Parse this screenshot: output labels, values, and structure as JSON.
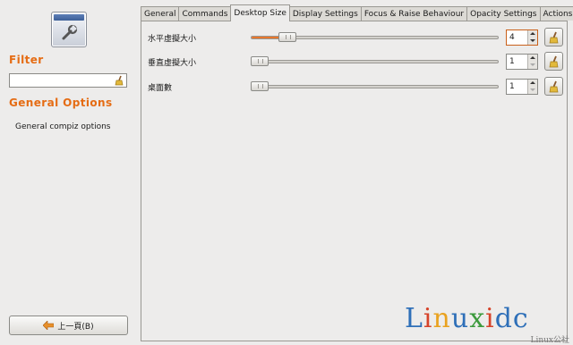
{
  "sidebar": {
    "filter_title": "Filter",
    "filter_value": "",
    "options_title": "General Options",
    "general_link": "General compiz options",
    "back_label": "上一頁(B)"
  },
  "tabs": [
    {
      "label": "General",
      "active": false
    },
    {
      "label": "Commands",
      "active": false
    },
    {
      "label": "Desktop Size",
      "active": true
    },
    {
      "label": "Display Settings",
      "active": false
    },
    {
      "label": "Focus & Raise Behaviour",
      "active": false
    },
    {
      "label": "Opacity Settings",
      "active": false
    },
    {
      "label": "Actions",
      "active": false
    }
  ],
  "settings": [
    {
      "label": "水平虛擬大小",
      "value": "4",
      "slider_fraction": 0.12,
      "focused": true
    },
    {
      "label": "垂直虛擬大小",
      "value": "1",
      "slider_fraction": 0.0,
      "focused": false
    },
    {
      "label": "桌面數",
      "value": "1",
      "slider_fraction": 0.0,
      "focused": false
    }
  ],
  "watermark": {
    "letters": [
      "L",
      "i",
      "n",
      "u",
      "x",
      "i",
      "dc"
    ],
    "sub": "Linux公社"
  },
  "icons": {
    "app": "settings-wrench-icon",
    "clear": "broom-icon",
    "reset": "broom-icon",
    "back": "arrow-left-icon"
  },
  "colors": {
    "accent": "#e56c14",
    "slider_fill": "#e8772c"
  }
}
